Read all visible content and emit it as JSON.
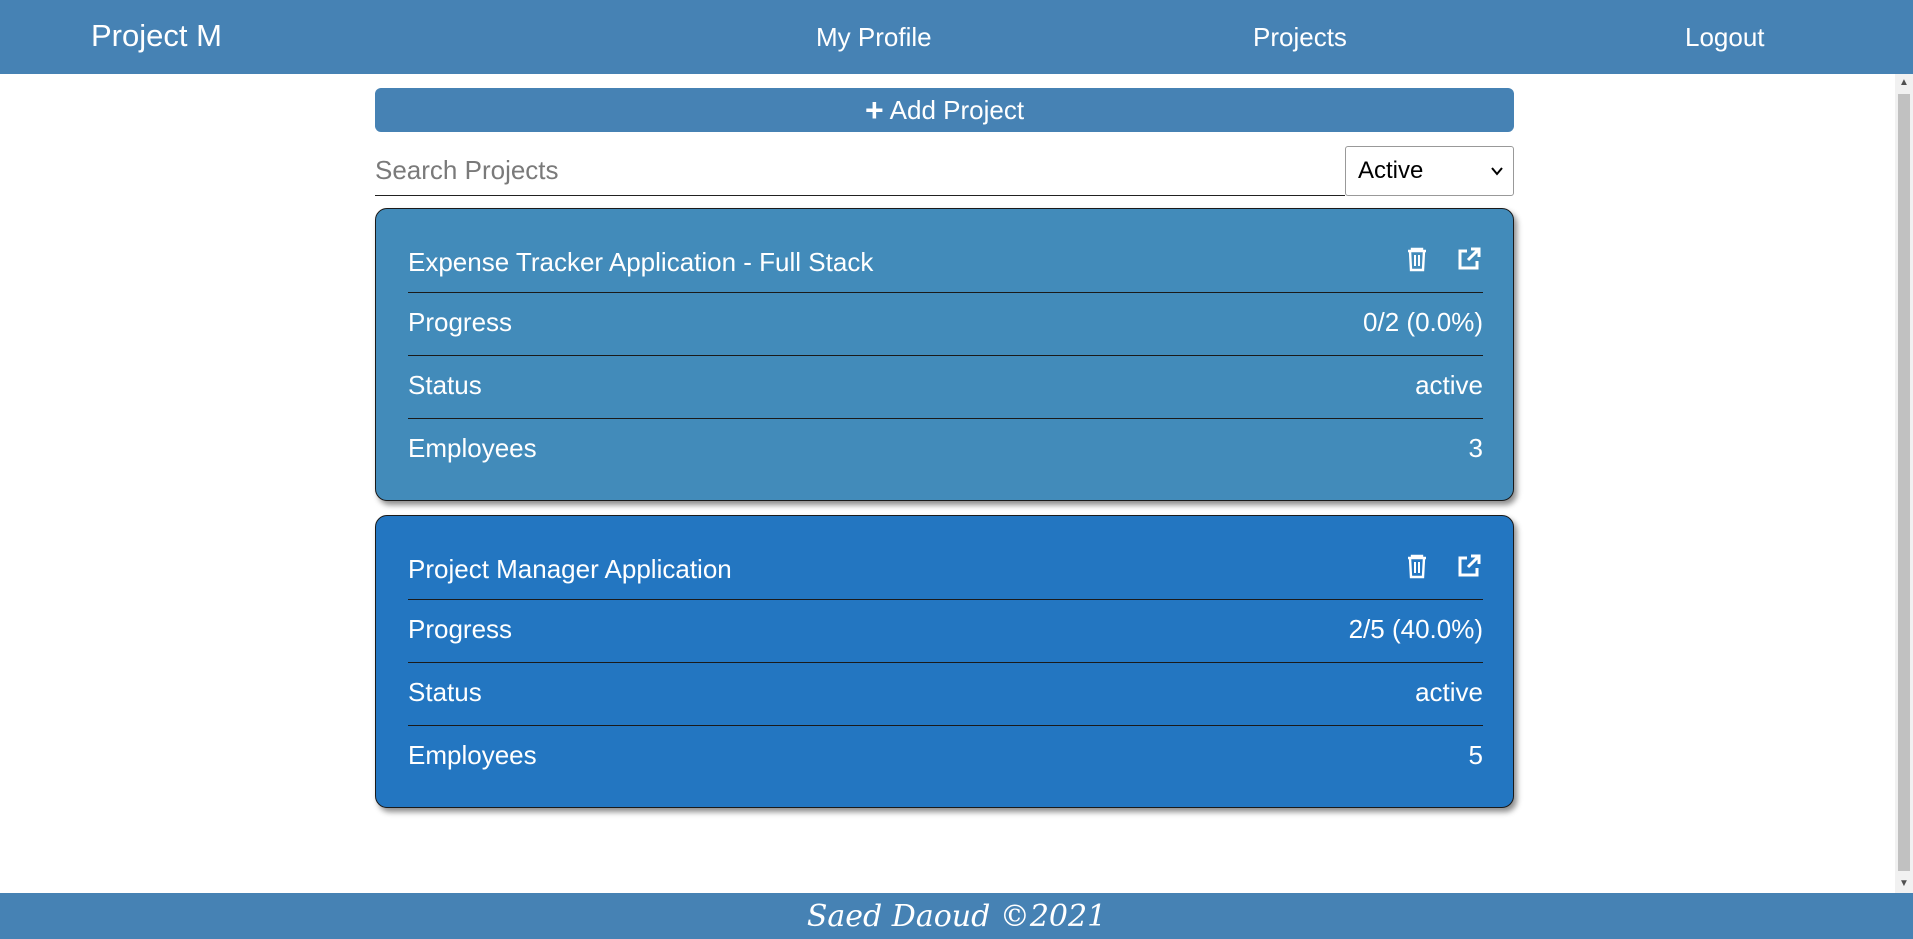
{
  "navbar": {
    "brand": "Project M",
    "links": [
      "My Profile",
      "Projects",
      "Logout"
    ]
  },
  "toolbar": {
    "add_label": "Add Project",
    "search_placeholder": "Search Projects",
    "filter_selected": "Active"
  },
  "projects": [
    {
      "title": "Expense Tracker Application - Full Stack",
      "progress_label": "Progress",
      "progress_value": "0/2 (0.0%)",
      "status_label": "Status",
      "status_value": "active",
      "employees_label": "Employees",
      "employees_value": "3"
    },
    {
      "title": "Project Manager Application",
      "progress_label": "Progress",
      "progress_value": "2/5 (40.0%)",
      "status_label": "Status",
      "status_value": "active",
      "employees_label": "Employees",
      "employees_value": "5"
    }
  ],
  "footer": {
    "text": "Saed Daoud ©2021"
  },
  "colors": {
    "navbar": "#4682b4",
    "card_1": "#428bba",
    "card_2": "#2376c1"
  },
  "icons": [
    "plus-icon",
    "trash-icon",
    "external-link-icon"
  ]
}
